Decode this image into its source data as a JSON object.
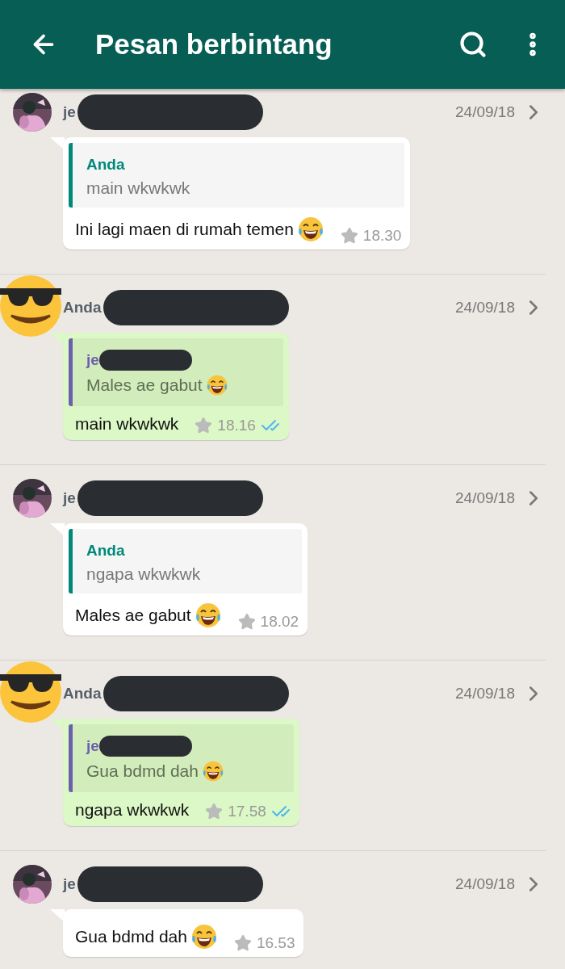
{
  "header": {
    "title": "Pesan berbintang"
  },
  "messages": [
    {
      "sender": {
        "kind": "contact",
        "name": "je",
        "redacted": true
      },
      "date": "24/09/18",
      "quote": {
        "kind": "self",
        "author": "Anda",
        "text": "main wkwkwk"
      },
      "text": "Ini lagi maen di rumah temen",
      "emoji": true,
      "time": "18.30",
      "outgoing": false
    },
    {
      "sender": {
        "kind": "self",
        "name": "Anda",
        "redacted": true
      },
      "date": "24/09/18",
      "quote": {
        "kind": "contact",
        "author": "je",
        "redacted": true,
        "text": "Males ae gabut",
        "emoji": true
      },
      "text": "main wkwkwk",
      "time": "18.16",
      "outgoing": true,
      "read": true
    },
    {
      "sender": {
        "kind": "contact",
        "name": "je",
        "redacted": true
      },
      "date": "24/09/18",
      "quote": {
        "kind": "self",
        "author": "Anda",
        "text": "ngapa wkwkwk"
      },
      "text": "Males ae gabut",
      "emoji": true,
      "time": "18.02",
      "outgoing": false
    },
    {
      "sender": {
        "kind": "self",
        "name": "Anda",
        "redacted": true
      },
      "date": "24/09/18",
      "quote": {
        "kind": "contact",
        "author": "je",
        "redacted": true,
        "text": "Gua bdmd dah",
        "emoji": true
      },
      "text": "ngapa wkwkwk",
      "time": "17.58",
      "outgoing": true,
      "read": true
    },
    {
      "sender": {
        "kind": "contact",
        "name": "je",
        "redacted": true
      },
      "date": "24/09/18",
      "text": "Gua bdmd dah",
      "emoji": true,
      "time": "16.53",
      "outgoing": false
    }
  ]
}
